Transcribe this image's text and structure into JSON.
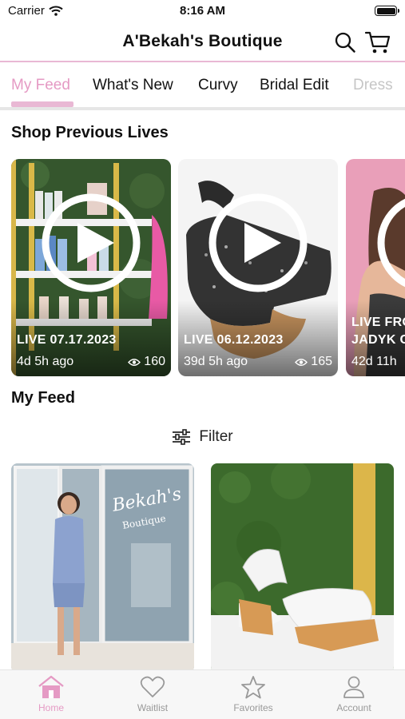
{
  "status_bar": {
    "carrier": "Carrier",
    "time": "8:16 AM"
  },
  "header": {
    "title": "A'Bekah's Boutique",
    "icons": [
      "search-icon",
      "cart-icon"
    ]
  },
  "tabs": [
    {
      "label": "My Feed",
      "active": true
    },
    {
      "label": "What's New",
      "active": false
    },
    {
      "label": "Curvy",
      "active": false
    },
    {
      "label": "Bridal Edit",
      "active": false
    },
    {
      "label": "Dress",
      "active": false
    }
  ],
  "previous_lives": {
    "title": "Shop Previous Lives",
    "items": [
      {
        "label": "LIVE 07.17.2023",
        "ago": "4d 5h ago",
        "views": "160"
      },
      {
        "label": "LIVE 06.12.2023",
        "ago": "39d 5h ago",
        "views": "165"
      },
      {
        "label": "LIVE FRO",
        "label2": "JADYK C",
        "ago": "42d 11h"
      }
    ]
  },
  "feed": {
    "title": "My Feed",
    "filter_label": "Filter"
  },
  "bottom_nav": [
    {
      "label": "Home",
      "icon": "home-icon",
      "active": true
    },
    {
      "label": "Waitlist",
      "icon": "heart-icon",
      "active": false
    },
    {
      "label": "Favorites",
      "icon": "star-icon",
      "active": false
    },
    {
      "label": "Account",
      "icon": "person-icon",
      "active": false
    }
  ],
  "colors": {
    "accent": "#e59ac4",
    "divider": "#e9b8d4"
  }
}
